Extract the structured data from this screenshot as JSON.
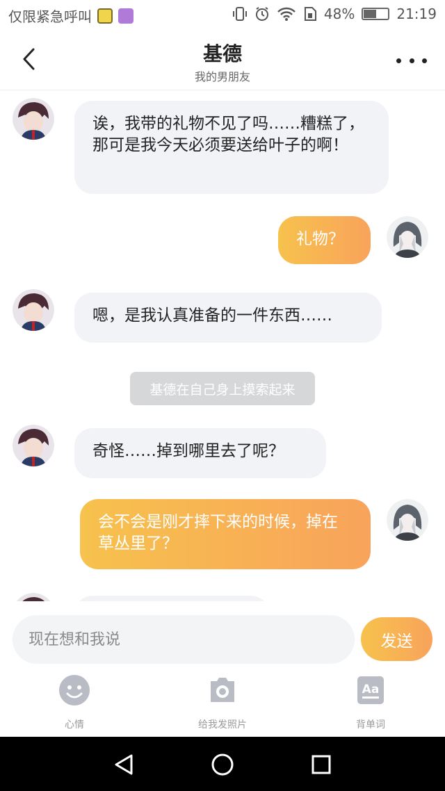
{
  "status_bar": {
    "carrier_text": "仅限紧急呼叫",
    "battery_text": "48%",
    "battery_level": 0.48,
    "time": "21:19",
    "icons": [
      "notification-icon",
      "gallery-icon",
      "vibrate-icon",
      "alarm-icon",
      "wifi-icon",
      "sim-icon",
      "battery-icon"
    ]
  },
  "header": {
    "title": "基德",
    "subtitle": "我的男朋友"
  },
  "messages": [
    {
      "side": "in",
      "text": "诶，我带的礼物不见了吗……糟糕了，那可是我今天必须要送给叶子的啊！"
    },
    {
      "side": "out",
      "text": "礼物？"
    },
    {
      "side": "in",
      "text": "嗯，是我认真准备的一件东西……"
    },
    {
      "side": "system",
      "text": "基德在自己身上摸索起来"
    },
    {
      "side": "in",
      "text": "奇怪……掉到哪里去了呢？"
    },
    {
      "side": "out",
      "text": "会不会是刚才摔下来的时候，掉在草丛里了？"
    }
  ],
  "input": {
    "placeholder": "现在想和我说",
    "send_label": "发送"
  },
  "toolbar": {
    "mood_label": "心情",
    "photo_label": "给我发照片",
    "vocab_label": "背单词"
  },
  "colors": {
    "accent_start": "#f7c24d",
    "accent_end": "#f8a35b",
    "incoming_bubble": "#f2f3f7",
    "system_bubble": "#d6d7d9",
    "icon_gray": "#b9bcc5"
  }
}
